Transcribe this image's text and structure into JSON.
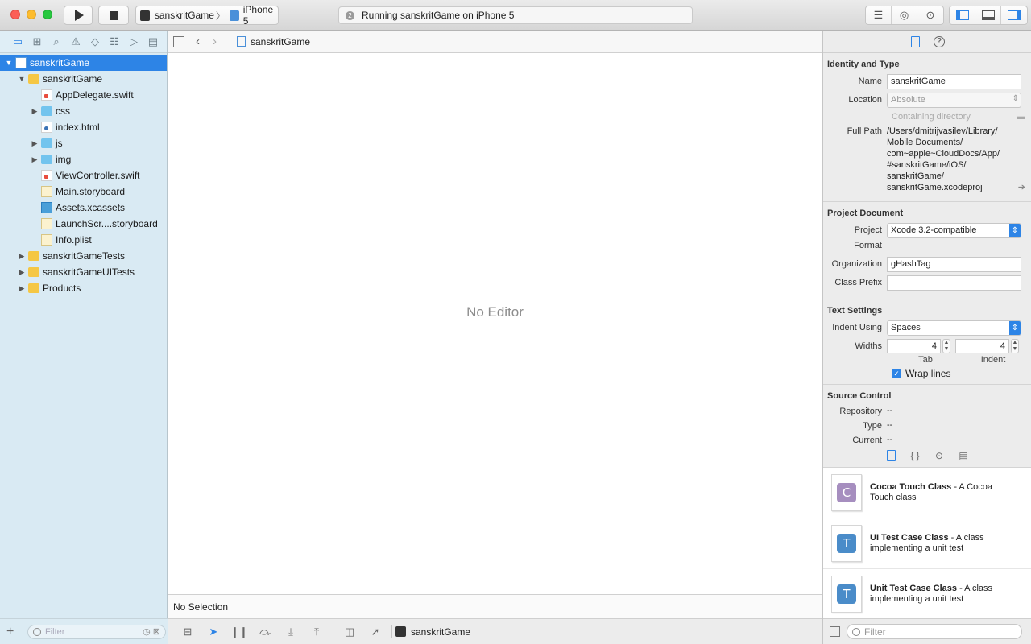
{
  "toolbar": {
    "scheme_name": "sanskritGame",
    "device_name": "iPhone 5",
    "activity_text": "Running sanskritGame on iPhone 5"
  },
  "navigator": {
    "tree": [
      {
        "label": "sanskritGame",
        "icon": "project-icon",
        "depth": 0,
        "disclosure": "open",
        "selected": true
      },
      {
        "label": "sanskritGame",
        "icon": "folder-icon",
        "depth": 1,
        "disclosure": "open"
      },
      {
        "label": "AppDelegate.swift",
        "icon": "swift-file-icon",
        "depth": 2,
        "disclosure": "none"
      },
      {
        "label": "css",
        "icon": "blue-folder-icon",
        "depth": 2,
        "disclosure": "closed"
      },
      {
        "label": "index.html",
        "icon": "html-file-icon",
        "depth": 2,
        "disclosure": "none"
      },
      {
        "label": "js",
        "icon": "blue-folder-icon",
        "depth": 2,
        "disclosure": "closed"
      },
      {
        "label": "img",
        "icon": "blue-folder-icon",
        "depth": 2,
        "disclosure": "closed"
      },
      {
        "label": "ViewController.swift",
        "icon": "swift-file-icon",
        "depth": 2,
        "disclosure": "none"
      },
      {
        "label": "Main.storyboard",
        "icon": "storyboard-icon",
        "depth": 2,
        "disclosure": "none"
      },
      {
        "label": "Assets.xcassets",
        "icon": "assets-icon",
        "depth": 2,
        "disclosure": "none"
      },
      {
        "label": "LaunchScr....storyboard",
        "icon": "storyboard-icon",
        "depth": 2,
        "disclosure": "none"
      },
      {
        "label": "Info.plist",
        "icon": "plist-icon",
        "depth": 2,
        "disclosure": "none"
      },
      {
        "label": "sanskritGameTests",
        "icon": "folder-icon",
        "depth": 1,
        "disclosure": "closed"
      },
      {
        "label": "sanskritGameUITests",
        "icon": "folder-icon",
        "depth": 1,
        "disclosure": "closed"
      },
      {
        "label": "Products",
        "icon": "folder-icon",
        "depth": 1,
        "disclosure": "closed"
      }
    ],
    "filter_placeholder": "Filter"
  },
  "editor": {
    "jump_bar_item": "sanskritGame",
    "empty_message": "No Editor",
    "debug_status": "No Selection",
    "debug_target": "sanskritGame"
  },
  "inspector": {
    "identity": {
      "title": "Identity and Type",
      "name_label": "Name",
      "name_value": "sanskritGame",
      "location_label": "Location",
      "location_value": "Absolute",
      "containing_dir": "Containing directory",
      "full_path_label": "Full Path",
      "full_path_lines": [
        "/Users/dmitrijvasilev/Library/",
        "Mobile Documents/",
        "com~apple~CloudDocs/App/",
        "#sanskritGame/iOS/",
        "sanskritGame/",
        "sanskritGame.xcodeproj"
      ]
    },
    "project_document": {
      "title": "Project Document",
      "format_label": "Project Format",
      "format_value": "Xcode 3.2-compatible",
      "org_label": "Organization",
      "org_value": "gHashTag",
      "prefix_label": "Class Prefix",
      "prefix_value": ""
    },
    "text_settings": {
      "title": "Text Settings",
      "indent_label": "Indent Using",
      "indent_value": "Spaces",
      "widths_label": "Widths",
      "tab_value": "4",
      "indent_width_value": "4",
      "tab_caption": "Tab",
      "indent_caption": "Indent",
      "wrap_label": "Wrap lines",
      "wrap_checked": true
    },
    "source_control": {
      "title": "Source Control",
      "rows": [
        {
          "label": "Repository",
          "value": "--"
        },
        {
          "label": "Type",
          "value": "--"
        },
        {
          "label": "Current Branch",
          "value": "--"
        }
      ]
    }
  },
  "library": {
    "items": [
      {
        "badge": "C",
        "title": "Cocoa Touch Class",
        "desc": " - A Cocoa Touch class"
      },
      {
        "badge": "T",
        "title": "UI Test Case Class",
        "desc": " - A class implementing a unit test"
      },
      {
        "badge": "T",
        "title": "Unit Test Case Class",
        "desc": " - A class implementing a unit test"
      }
    ],
    "filter_placeholder": "Filter"
  }
}
